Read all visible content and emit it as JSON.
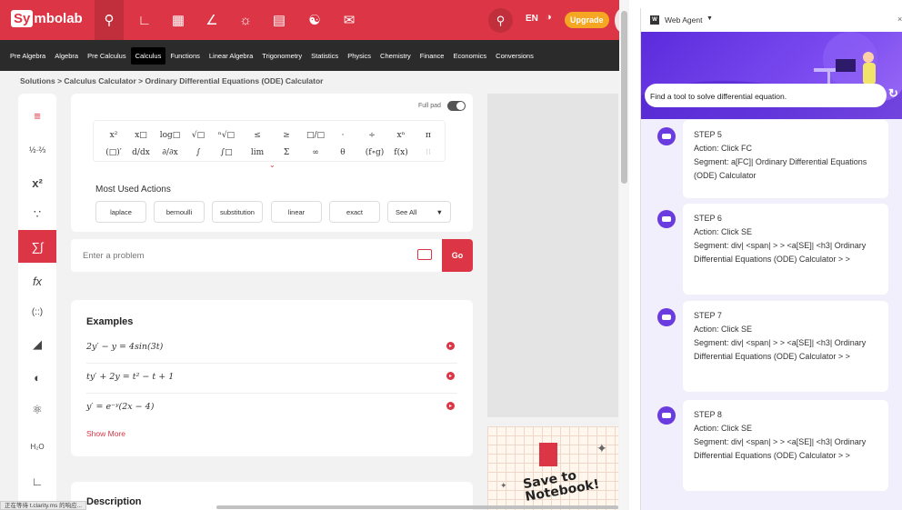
{
  "top": {
    "logo_sy": "Sy",
    "logo_rest": "mbolab",
    "lang": "EN",
    "upgrade": "Upgrade"
  },
  "subnav": [
    "Pre Algebra",
    "Algebra",
    "Pre Calculus",
    "Calculus",
    "Functions",
    "Linear Algebra",
    "Trigonometry",
    "Statistics",
    "Physics",
    "Chemistry",
    "Finance",
    "Economics",
    "Conversions"
  ],
  "breadcrumb": "Solutions > Calculus Calculator > Ordinary Differential Equations (ODE) Calculator",
  "pad": {
    "full_pad": "Full pad",
    "most_used": "Most Used Actions",
    "actions": [
      "laplace",
      "bernoulli",
      "substitution",
      "linear",
      "exact"
    ],
    "see_all": "See All",
    "keys_row1": [
      "x²",
      "x□",
      "log□",
      "√□",
      "ⁿ√□",
      "≤",
      "≥",
      "□/□",
      "·",
      "÷",
      "xⁿ",
      "π"
    ],
    "keys_row2": [
      "(□)′",
      "d/dx",
      "∂/∂x",
      "∫",
      "∫□",
      "lim",
      "Σ",
      "∞",
      "θ",
      "(f∘g)",
      "f(x)",
      "⁝⁝"
    ]
  },
  "problem": {
    "placeholder": "Enter a problem",
    "go": "Go"
  },
  "examples": {
    "title": "Examples",
    "items": [
      "2y′ − y = 4sin(3t)",
      "ty′ + 2y = t² − t + 1",
      "y′ = e⁻ʸ(2x − 4)"
    ],
    "show_more": "Show More"
  },
  "description": "Description",
  "notebook": {
    "line1": "Save to",
    "line2": "Notebook!"
  },
  "status": "正在等待 t.clarity.ms 的响应...",
  "agent": {
    "title": "Web Agent",
    "task": "Find a tool to solve differential equation.",
    "steps": [
      {
        "step": "STEP 5",
        "action": "Action: Click FC",
        "segment": "Segment: a[FC]| Ordinary Differential Equations (ODE) Calculator"
      },
      {
        "step": "STEP 6",
        "action": "Action: Click SE",
        "segment": "Segment: div| <span| > > <a[SE]| <h3| Ordinary Differential Equations (ODE) Calculator > >"
      },
      {
        "step": "STEP 7",
        "action": "Action: Click SE",
        "segment": "Segment: div| <span| > > <a[SE]| <h3| Ordinary Differential Equations (ODE) Calculator > >"
      },
      {
        "step": "STEP 8",
        "action": "Action: Click SE",
        "segment": "Segment: div| <span| > > <a[SE]| <h3| Ordinary Differential Equations (ODE) Calculator > >"
      }
    ]
  },
  "colors": {
    "brand": "#dc3545",
    "agent": "#6a3ce0"
  }
}
